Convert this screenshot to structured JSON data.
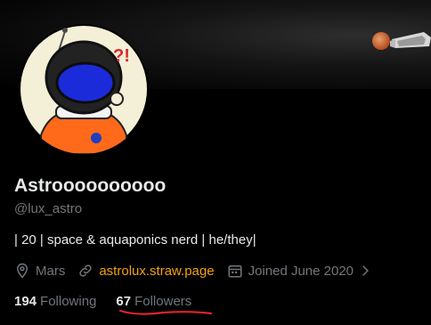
{
  "colors": {
    "background": "#000000",
    "text_primary": "#e7e9ea",
    "text_secondary": "#71767b",
    "link": "#f3a00e",
    "annotation": "#e0242a"
  },
  "profile": {
    "display_name": "Astroooooooooo",
    "handle": "@lux_astro",
    "bio": "| 20 | space & aquaponics nerd | he/they|",
    "location": "Mars",
    "website": "astrolux.straw.page",
    "joined": "Joined June 2020"
  },
  "icons": {
    "location": "map-pin-icon",
    "website": "link-icon",
    "joined": "calendar-icon",
    "more": "chevron-right-icon"
  },
  "stats": {
    "following_count": "194",
    "following_label": "Following",
    "followers_count": "67",
    "followers_label": "Followers"
  },
  "avatar": {
    "speech_text": "?!"
  }
}
